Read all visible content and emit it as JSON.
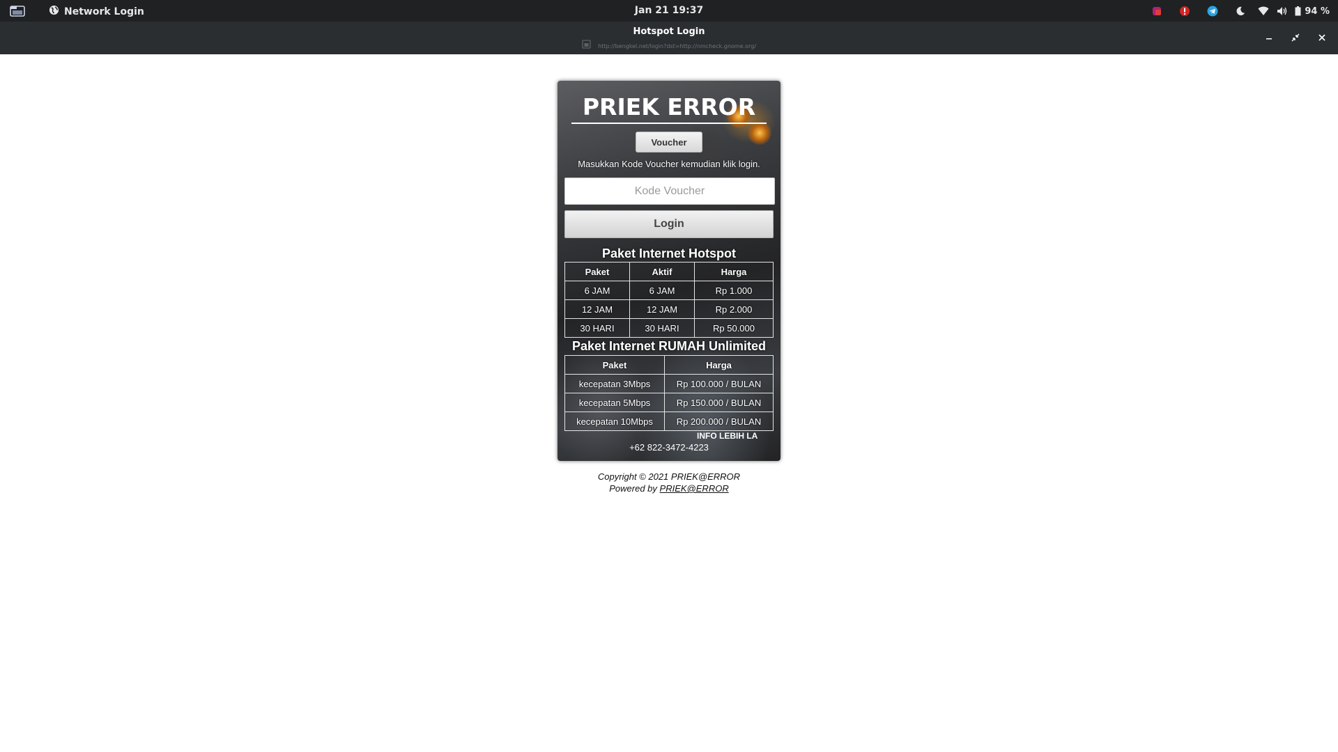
{
  "system_bar": {
    "app_name": "Network Login",
    "clock": "Jan 21  19:37",
    "battery": "94 %"
  },
  "window": {
    "title": "Hotspot Login",
    "url": "http://bengkel.net/login?dst=http://nmcheck.gnome.org/"
  },
  "card": {
    "brand": "PRIEK ERROR",
    "tab_label": "Voucher",
    "instructions": "Masukkan Kode Voucher kemudian klik login.",
    "voucher_placeholder": "Kode Voucher",
    "login_label": "Login",
    "hotspot": {
      "title": "Paket Internet Hotspot",
      "headers": [
        "Paket",
        "Aktif",
        "Harga"
      ],
      "rows": [
        [
          "6 JAM",
          "6 JAM",
          "Rp 1.000"
        ],
        [
          "12 JAM",
          "12 JAM",
          "Rp 2.000"
        ],
        [
          "30 HARI",
          "30 HARI",
          "Rp 50.000"
        ]
      ]
    },
    "rumah": {
      "title": "Paket Internet RUMAH Unlimited",
      "headers": [
        "Paket",
        "Harga"
      ],
      "rows": [
        [
          "kecepatan 3Mbps",
          "Rp 100.000 / BULAN"
        ],
        [
          "kecepatan 5Mbps",
          "Rp 150.000 / BULAN"
        ],
        [
          "kecepatan 10Mbps",
          "Rp 200.000 / BULAN"
        ]
      ]
    },
    "marquee": "INFO LEBIH LA",
    "phone": "+62 822-3472-4223"
  },
  "footer": {
    "copyright": "Copyright © 2021 PRIEK@ERROR",
    "powered_prefix": "Powered by",
    "powered_link": "PRIEK@ERROR"
  }
}
